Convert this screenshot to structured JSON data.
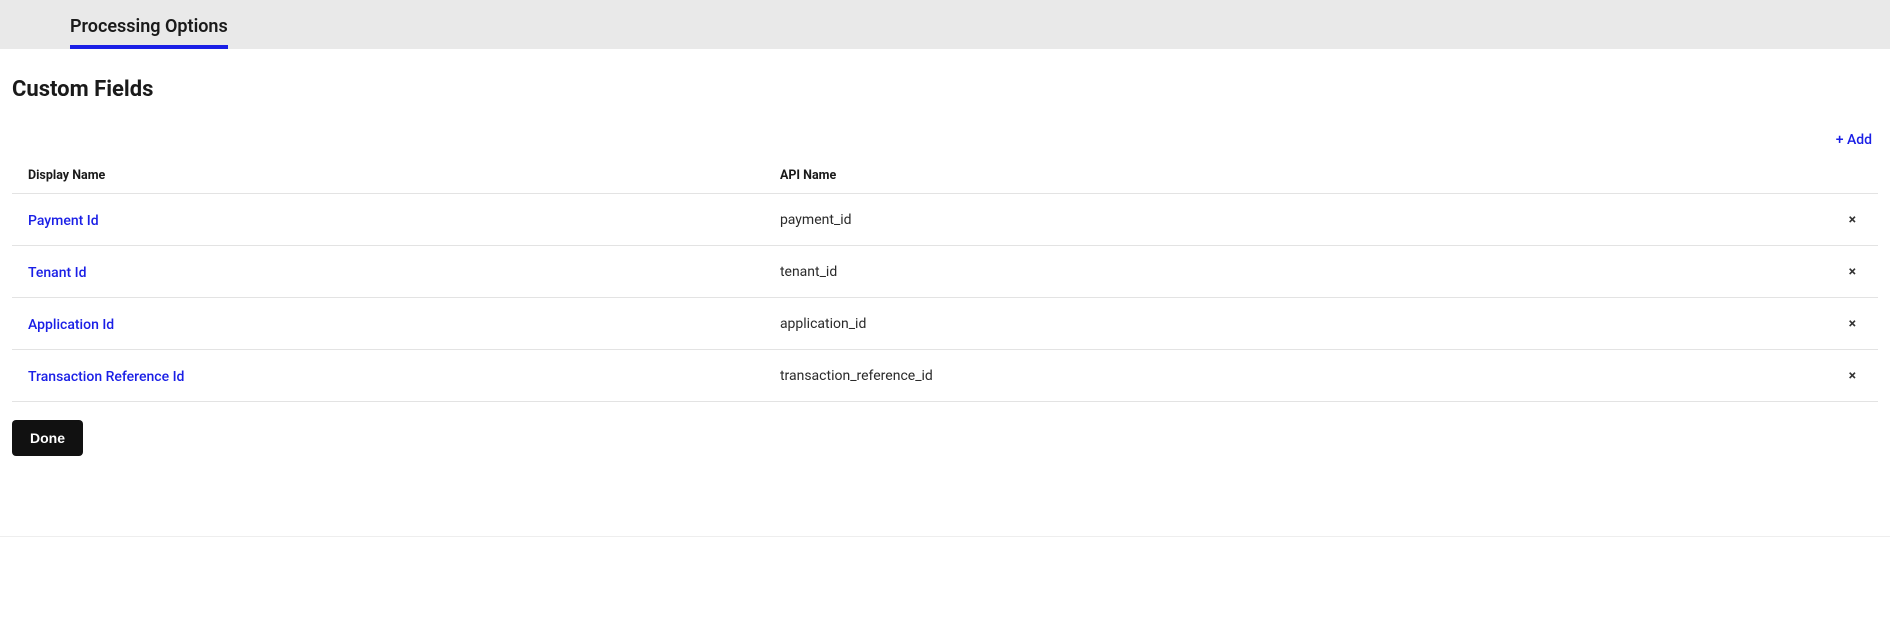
{
  "tab": {
    "label": "Processing Options"
  },
  "section": {
    "title": "Custom Fields"
  },
  "actions": {
    "add_label": "+ Add",
    "done_label": "Done"
  },
  "table": {
    "headers": {
      "display_name": "Display Name",
      "api_name": "API Name"
    },
    "rows": [
      {
        "display_name": "Payment Id",
        "api_name": "payment_id"
      },
      {
        "display_name": "Tenant Id",
        "api_name": "tenant_id"
      },
      {
        "display_name": "Application Id",
        "api_name": "application_id"
      },
      {
        "display_name": "Transaction Reference Id",
        "api_name": "transaction_reference_id"
      }
    ]
  },
  "icons": {
    "delete_glyph": "×"
  }
}
